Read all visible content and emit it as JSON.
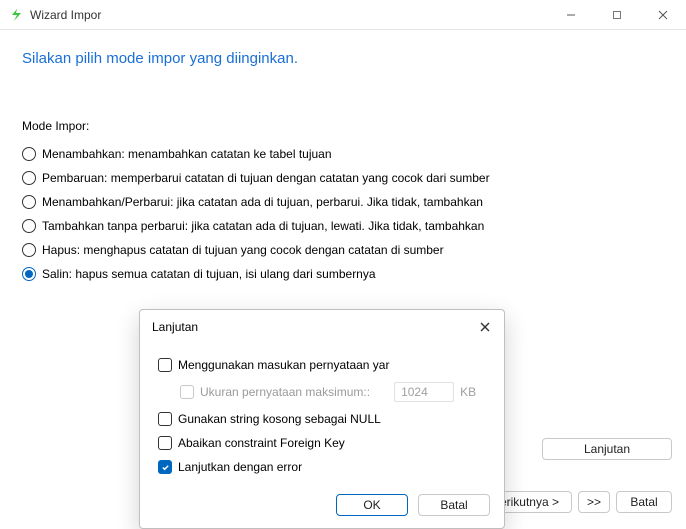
{
  "titlebar": {
    "title": "Wizard Impor"
  },
  "heading": "Silakan pilih mode impor yang diinginkan.",
  "modeLabel": "Mode Impor:",
  "radios": [
    {
      "label": "Menambahkan: menambahkan catatan ke tabel tujuan",
      "selected": false
    },
    {
      "label": "Pembaruan: memperbarui catatan di tujuan dengan catatan yang cocok dari sumber",
      "selected": false
    },
    {
      "label": "Menambahkan/Perbarui: jika catatan ada di tujuan, perbarui. Jika tidak, tambahkan",
      "selected": false
    },
    {
      "label": "Tambahkan tanpa perbarui: jika catatan ada di tujuan, lewati. Jika tidak, tambahkan",
      "selected": false
    },
    {
      "label": "Hapus: menghapus catatan di tujuan yang cocok dengan catatan di sumber",
      "selected": false
    },
    {
      "label": "Salin: hapus semua catatan di tujuan, isi ulang dari sumbernya",
      "selected": true
    }
  ],
  "sideButton": "Lanjutan",
  "footer": {
    "next": "Berikutnya >",
    "fast": ">>",
    "cancel": "Batal"
  },
  "modal": {
    "title": "Lanjutan",
    "checkboxes": {
      "multiInsert": "Menggunakan masukan pernyataan yar",
      "maxStmt": "Ukuran pernyataan maksimum::",
      "maxStmtValue": "1024",
      "kb": "KB",
      "emptyNull": "Gunakan string kosong sebagai NULL",
      "ignoreFk": "Abaikan constraint Foreign Key",
      "continueErr": "Lanjutkan dengan error"
    },
    "ok": "OK",
    "cancel": "Batal"
  }
}
